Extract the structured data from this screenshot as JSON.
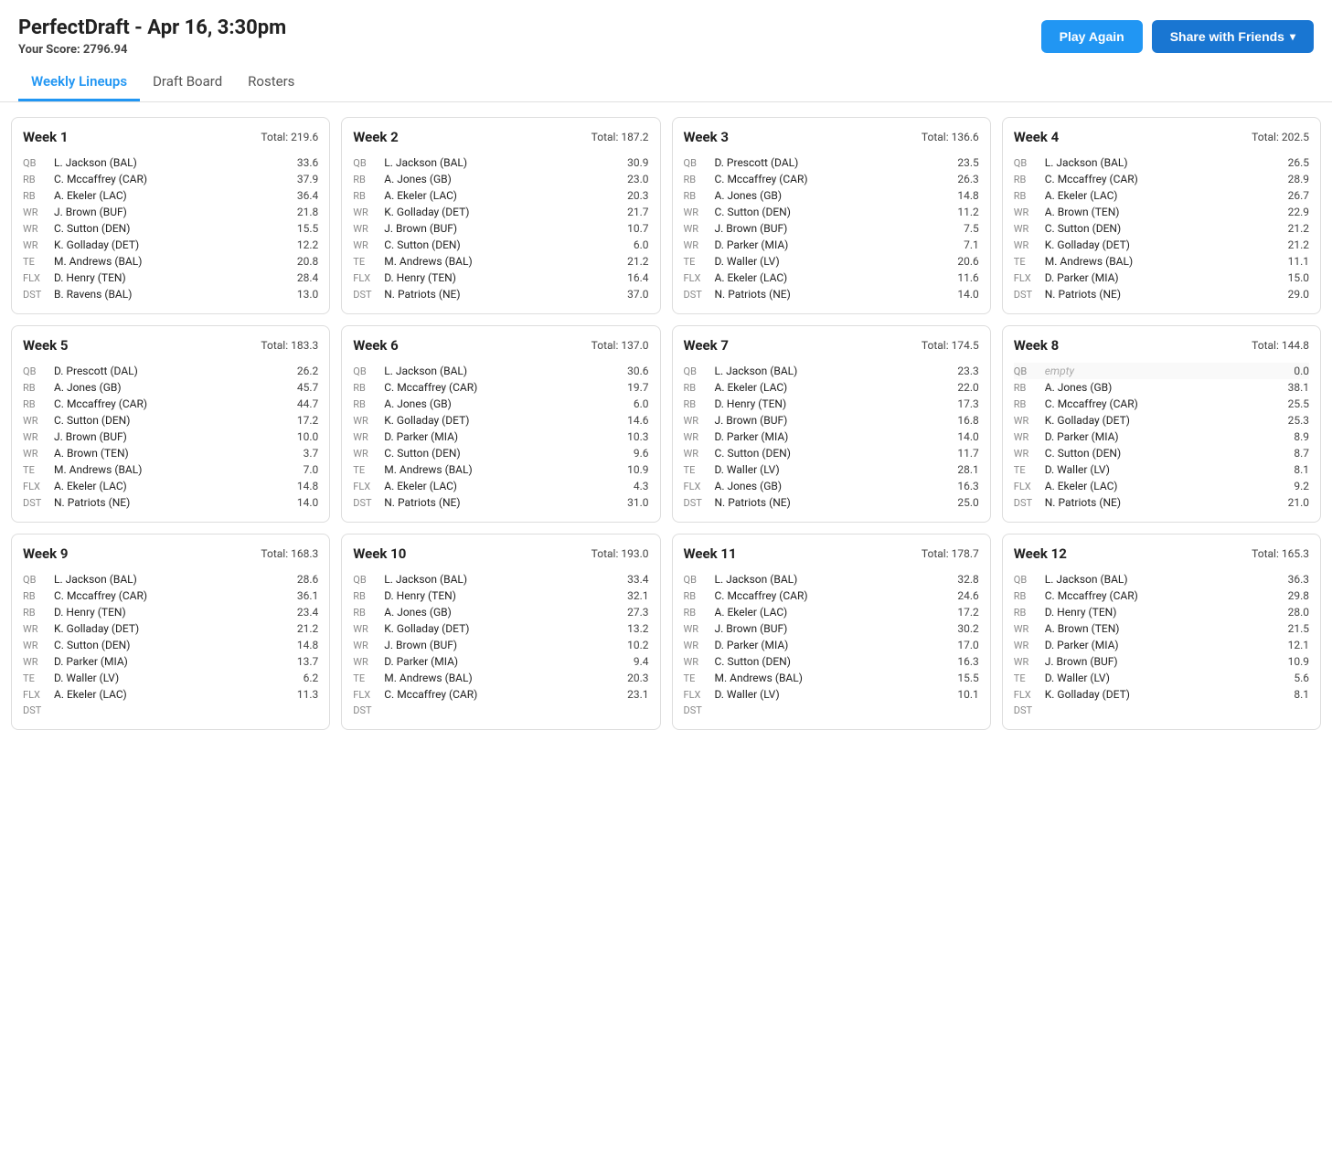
{
  "header": {
    "title": "PerfectDraft - Apr 16, 3:30pm",
    "score_label": "Your Score:",
    "score_value": "2796.94",
    "play_again": "Play Again",
    "share": "Share with Friends"
  },
  "nav": {
    "items": [
      "Weekly Lineups",
      "Draft Board",
      "Rosters"
    ],
    "active": 0
  },
  "weeks": [
    {
      "label": "Week 1",
      "total": "Total: 219.6",
      "players": [
        {
          "pos": "QB",
          "name": "L. Jackson (BAL)",
          "score": "33.6",
          "empty": false
        },
        {
          "pos": "RB",
          "name": "C. Mccaffrey (CAR)",
          "score": "37.9",
          "empty": false
        },
        {
          "pos": "RB",
          "name": "A. Ekeler (LAC)",
          "score": "36.4",
          "empty": false
        },
        {
          "pos": "WR",
          "name": "J. Brown (BUF)",
          "score": "21.8",
          "empty": false
        },
        {
          "pos": "WR",
          "name": "C. Sutton (DEN)",
          "score": "15.5",
          "empty": false
        },
        {
          "pos": "WR",
          "name": "K. Golladay (DET)",
          "score": "12.2",
          "empty": false
        },
        {
          "pos": "TE",
          "name": "M. Andrews (BAL)",
          "score": "20.8",
          "empty": false
        },
        {
          "pos": "FLX",
          "name": "D. Henry (TEN)",
          "score": "28.4",
          "empty": false
        },
        {
          "pos": "DST",
          "name": "B. Ravens (BAL)",
          "score": "13.0",
          "empty": false
        }
      ]
    },
    {
      "label": "Week 2",
      "total": "Total: 187.2",
      "players": [
        {
          "pos": "QB",
          "name": "L. Jackson (BAL)",
          "score": "30.9",
          "empty": false
        },
        {
          "pos": "RB",
          "name": "A. Jones (GB)",
          "score": "23.0",
          "empty": false
        },
        {
          "pos": "RB",
          "name": "A. Ekeler (LAC)",
          "score": "20.3",
          "empty": false
        },
        {
          "pos": "WR",
          "name": "K. Golladay (DET)",
          "score": "21.7",
          "empty": false
        },
        {
          "pos": "WR",
          "name": "J. Brown (BUF)",
          "score": "10.7",
          "empty": false
        },
        {
          "pos": "WR",
          "name": "C. Sutton (DEN)",
          "score": "6.0",
          "empty": false
        },
        {
          "pos": "TE",
          "name": "M. Andrews (BAL)",
          "score": "21.2",
          "empty": false
        },
        {
          "pos": "FLX",
          "name": "D. Henry (TEN)",
          "score": "16.4",
          "empty": false
        },
        {
          "pos": "DST",
          "name": "N. Patriots (NE)",
          "score": "37.0",
          "empty": false
        }
      ]
    },
    {
      "label": "Week 3",
      "total": "Total: 136.6",
      "players": [
        {
          "pos": "QB",
          "name": "D. Prescott (DAL)",
          "score": "23.5",
          "empty": false
        },
        {
          "pos": "RB",
          "name": "C. Mccaffrey (CAR)",
          "score": "26.3",
          "empty": false
        },
        {
          "pos": "RB",
          "name": "A. Jones (GB)",
          "score": "14.8",
          "empty": false
        },
        {
          "pos": "WR",
          "name": "C. Sutton (DEN)",
          "score": "11.2",
          "empty": false
        },
        {
          "pos": "WR",
          "name": "J. Brown (BUF)",
          "score": "7.5",
          "empty": false
        },
        {
          "pos": "WR",
          "name": "D. Parker (MIA)",
          "score": "7.1",
          "empty": false
        },
        {
          "pos": "TE",
          "name": "D. Waller (LV)",
          "score": "20.6",
          "empty": false
        },
        {
          "pos": "FLX",
          "name": "A. Ekeler (LAC)",
          "score": "11.6",
          "empty": false
        },
        {
          "pos": "DST",
          "name": "N. Patriots (NE)",
          "score": "14.0",
          "empty": false
        }
      ]
    },
    {
      "label": "Week 4",
      "total": "Total: 202.5",
      "players": [
        {
          "pos": "QB",
          "name": "L. Jackson (BAL)",
          "score": "26.5",
          "empty": false
        },
        {
          "pos": "RB",
          "name": "C. Mccaffrey (CAR)",
          "score": "28.9",
          "empty": false
        },
        {
          "pos": "RB",
          "name": "A. Ekeler (LAC)",
          "score": "26.7",
          "empty": false
        },
        {
          "pos": "WR",
          "name": "A. Brown (TEN)",
          "score": "22.9",
          "empty": false
        },
        {
          "pos": "WR",
          "name": "C. Sutton (DEN)",
          "score": "21.2",
          "empty": false
        },
        {
          "pos": "WR",
          "name": "K. Golladay (DET)",
          "score": "21.2",
          "empty": false
        },
        {
          "pos": "TE",
          "name": "M. Andrews (BAL)",
          "score": "11.1",
          "empty": false
        },
        {
          "pos": "FLX",
          "name": "D. Parker (MIA)",
          "score": "15.0",
          "empty": false
        },
        {
          "pos": "DST",
          "name": "N. Patriots (NE)",
          "score": "29.0",
          "empty": false
        }
      ]
    },
    {
      "label": "Week 5",
      "total": "Total: 183.3",
      "players": [
        {
          "pos": "QB",
          "name": "D. Prescott (DAL)",
          "score": "26.2",
          "empty": false
        },
        {
          "pos": "RB",
          "name": "A. Jones (GB)",
          "score": "45.7",
          "empty": false
        },
        {
          "pos": "RB",
          "name": "C. Mccaffrey (CAR)",
          "score": "44.7",
          "empty": false
        },
        {
          "pos": "WR",
          "name": "C. Sutton (DEN)",
          "score": "17.2",
          "empty": false
        },
        {
          "pos": "WR",
          "name": "J. Brown (BUF)",
          "score": "10.0",
          "empty": false
        },
        {
          "pos": "WR",
          "name": "A. Brown (TEN)",
          "score": "3.7",
          "empty": false
        },
        {
          "pos": "TE",
          "name": "M. Andrews (BAL)",
          "score": "7.0",
          "empty": false
        },
        {
          "pos": "FLX",
          "name": "A. Ekeler (LAC)",
          "score": "14.8",
          "empty": false
        },
        {
          "pos": "DST",
          "name": "N. Patriots (NE)",
          "score": "14.0",
          "empty": false
        }
      ]
    },
    {
      "label": "Week 6",
      "total": "Total: 137.0",
      "players": [
        {
          "pos": "QB",
          "name": "L. Jackson (BAL)",
          "score": "30.6",
          "empty": false
        },
        {
          "pos": "RB",
          "name": "C. Mccaffrey (CAR)",
          "score": "19.7",
          "empty": false
        },
        {
          "pos": "RB",
          "name": "A. Jones (GB)",
          "score": "6.0",
          "empty": false
        },
        {
          "pos": "WR",
          "name": "K. Golladay (DET)",
          "score": "14.6",
          "empty": false
        },
        {
          "pos": "WR",
          "name": "D. Parker (MIA)",
          "score": "10.3",
          "empty": false
        },
        {
          "pos": "WR",
          "name": "C. Sutton (DEN)",
          "score": "9.6",
          "empty": false
        },
        {
          "pos": "TE",
          "name": "M. Andrews (BAL)",
          "score": "10.9",
          "empty": false
        },
        {
          "pos": "FLX",
          "name": "A. Ekeler (LAC)",
          "score": "4.3",
          "empty": false
        },
        {
          "pos": "DST",
          "name": "N. Patriots (NE)",
          "score": "31.0",
          "empty": false
        }
      ]
    },
    {
      "label": "Week 7",
      "total": "Total: 174.5",
      "players": [
        {
          "pos": "QB",
          "name": "L. Jackson (BAL)",
          "score": "23.3",
          "empty": false
        },
        {
          "pos": "RB",
          "name": "A. Ekeler (LAC)",
          "score": "22.0",
          "empty": false
        },
        {
          "pos": "RB",
          "name": "D. Henry (TEN)",
          "score": "17.3",
          "empty": false
        },
        {
          "pos": "WR",
          "name": "J. Brown (BUF)",
          "score": "16.8",
          "empty": false
        },
        {
          "pos": "WR",
          "name": "D. Parker (MIA)",
          "score": "14.0",
          "empty": false
        },
        {
          "pos": "WR",
          "name": "C. Sutton (DEN)",
          "score": "11.7",
          "empty": false
        },
        {
          "pos": "TE",
          "name": "D. Waller (LV)",
          "score": "28.1",
          "empty": false
        },
        {
          "pos": "FLX",
          "name": "A. Jones (GB)",
          "score": "16.3",
          "empty": false
        },
        {
          "pos": "DST",
          "name": "N. Patriots (NE)",
          "score": "25.0",
          "empty": false
        }
      ]
    },
    {
      "label": "Week 8",
      "total": "Total: 144.8",
      "players": [
        {
          "pos": "QB",
          "name": "empty",
          "score": "0.0",
          "empty": true
        },
        {
          "pos": "RB",
          "name": "A. Jones (GB)",
          "score": "38.1",
          "empty": false
        },
        {
          "pos": "RB",
          "name": "C. Mccaffrey (CAR)",
          "score": "25.5",
          "empty": false
        },
        {
          "pos": "WR",
          "name": "K. Golladay (DET)",
          "score": "25.3",
          "empty": false
        },
        {
          "pos": "WR",
          "name": "D. Parker (MIA)",
          "score": "8.9",
          "empty": false
        },
        {
          "pos": "WR",
          "name": "C. Sutton (DEN)",
          "score": "8.7",
          "empty": false
        },
        {
          "pos": "TE",
          "name": "D. Waller (LV)",
          "score": "8.1",
          "empty": false
        },
        {
          "pos": "FLX",
          "name": "A. Ekeler (LAC)",
          "score": "9.2",
          "empty": false
        },
        {
          "pos": "DST",
          "name": "N. Patriots (NE)",
          "score": "21.0",
          "empty": false
        }
      ]
    },
    {
      "label": "Week 9",
      "total": "Total: 168.3",
      "players": [
        {
          "pos": "QB",
          "name": "L. Jackson (BAL)",
          "score": "28.6",
          "empty": false
        },
        {
          "pos": "RB",
          "name": "C. Mccaffrey (CAR)",
          "score": "36.1",
          "empty": false
        },
        {
          "pos": "RB",
          "name": "D. Henry (TEN)",
          "score": "23.4",
          "empty": false
        },
        {
          "pos": "WR",
          "name": "K. Golladay (DET)",
          "score": "21.2",
          "empty": false
        },
        {
          "pos": "WR",
          "name": "C. Sutton (DEN)",
          "score": "14.8",
          "empty": false
        },
        {
          "pos": "WR",
          "name": "D. Parker (MIA)",
          "score": "13.7",
          "empty": false
        },
        {
          "pos": "TE",
          "name": "D. Waller (LV)",
          "score": "6.2",
          "empty": false
        },
        {
          "pos": "FLX",
          "name": "A. Ekeler (LAC)",
          "score": "11.3",
          "empty": false
        },
        {
          "pos": "DST",
          "name": "",
          "score": "",
          "empty": false
        }
      ]
    },
    {
      "label": "Week 10",
      "total": "Total: 193.0",
      "players": [
        {
          "pos": "QB",
          "name": "L. Jackson (BAL)",
          "score": "33.4",
          "empty": false
        },
        {
          "pos": "RB",
          "name": "D. Henry (TEN)",
          "score": "32.1",
          "empty": false
        },
        {
          "pos": "RB",
          "name": "A. Jones (GB)",
          "score": "27.3",
          "empty": false
        },
        {
          "pos": "WR",
          "name": "K. Golladay (DET)",
          "score": "13.2",
          "empty": false
        },
        {
          "pos": "WR",
          "name": "J. Brown (BUF)",
          "score": "10.2",
          "empty": false
        },
        {
          "pos": "WR",
          "name": "D. Parker (MIA)",
          "score": "9.4",
          "empty": false
        },
        {
          "pos": "TE",
          "name": "M. Andrews (BAL)",
          "score": "20.3",
          "empty": false
        },
        {
          "pos": "FLX",
          "name": "C. Mccaffrey (CAR)",
          "score": "23.1",
          "empty": false
        },
        {
          "pos": "DST",
          "name": "",
          "score": "",
          "empty": false
        }
      ]
    },
    {
      "label": "Week 11",
      "total": "Total: 178.7",
      "players": [
        {
          "pos": "QB",
          "name": "L. Jackson (BAL)",
          "score": "32.8",
          "empty": false
        },
        {
          "pos": "RB",
          "name": "C. Mccaffrey (CAR)",
          "score": "24.6",
          "empty": false
        },
        {
          "pos": "RB",
          "name": "A. Ekeler (LAC)",
          "score": "17.2",
          "empty": false
        },
        {
          "pos": "WR",
          "name": "J. Brown (BUF)",
          "score": "30.2",
          "empty": false
        },
        {
          "pos": "WR",
          "name": "D. Parker (MIA)",
          "score": "17.0",
          "empty": false
        },
        {
          "pos": "WR",
          "name": "C. Sutton (DEN)",
          "score": "16.3",
          "empty": false
        },
        {
          "pos": "TE",
          "name": "M. Andrews (BAL)",
          "score": "15.5",
          "empty": false
        },
        {
          "pos": "FLX",
          "name": "D. Waller (LV)",
          "score": "10.1",
          "empty": false
        },
        {
          "pos": "DST",
          "name": "",
          "score": "",
          "empty": false
        }
      ]
    },
    {
      "label": "Week 12",
      "total": "Total: 165.3",
      "players": [
        {
          "pos": "QB",
          "name": "L. Jackson (BAL)",
          "score": "36.3",
          "empty": false
        },
        {
          "pos": "RB",
          "name": "C. Mccaffrey (CAR)",
          "score": "29.8",
          "empty": false
        },
        {
          "pos": "RB",
          "name": "D. Henry (TEN)",
          "score": "28.0",
          "empty": false
        },
        {
          "pos": "WR",
          "name": "A. Brown (TEN)",
          "score": "21.5",
          "empty": false
        },
        {
          "pos": "WR",
          "name": "D. Parker (MIA)",
          "score": "12.1",
          "empty": false
        },
        {
          "pos": "WR",
          "name": "J. Brown (BUF)",
          "score": "10.9",
          "empty": false
        },
        {
          "pos": "TE",
          "name": "D. Waller (LV)",
          "score": "5.6",
          "empty": false
        },
        {
          "pos": "FLX",
          "name": "K. Golladay (DET)",
          "score": "8.1",
          "empty": false
        },
        {
          "pos": "DST",
          "name": "",
          "score": "",
          "empty": false
        }
      ]
    }
  ]
}
